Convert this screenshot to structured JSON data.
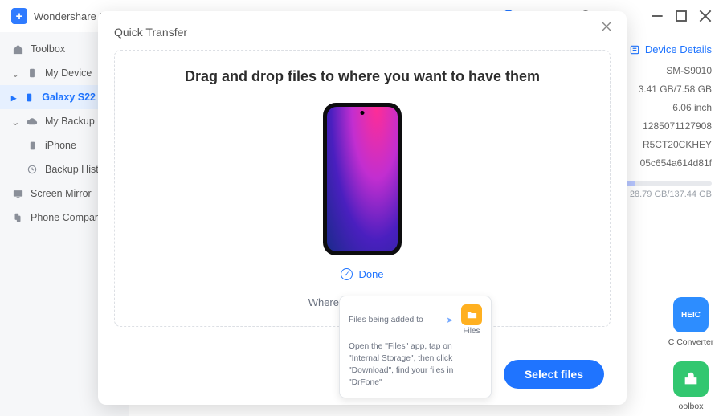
{
  "titlebar": {
    "brand": "Wondershare Dr.Fone"
  },
  "sidebar": {
    "toolbox": "Toolbox",
    "my_device": "My Device",
    "galaxy": "Galaxy S22",
    "my_backup": "My Backup",
    "iphone": "iPhone",
    "backup_history": "Backup History",
    "screen_mirror": "Screen Mirror",
    "phone_companion": "Phone Companion"
  },
  "details": {
    "title": "Device Details",
    "model": "SM-S9010",
    "storage": "3.41 GB/7.58 GB",
    "screen": "6.06 inch",
    "imei": "1285071127908",
    "serial": "R5CT20CKHEY",
    "id2": "05c654a614d81f",
    "storage_total": "28.79 GB/137.44 GB"
  },
  "cards": {
    "heic": "HEIC",
    "heic_label": "C Converter",
    "toolbox_label": "oolbox"
  },
  "modal": {
    "title": "Quick Transfer",
    "heading": "Drag and drop files to where you want to have them",
    "done": "Done",
    "where": "Where are my files?",
    "select": "Select files"
  },
  "tooltip": {
    "top": "Files being added to",
    "files": "Files",
    "body": "Open the \"Files\" app, tap on \"Internal Storage\", then click \"Download\", find your files in \"DrFone\""
  }
}
